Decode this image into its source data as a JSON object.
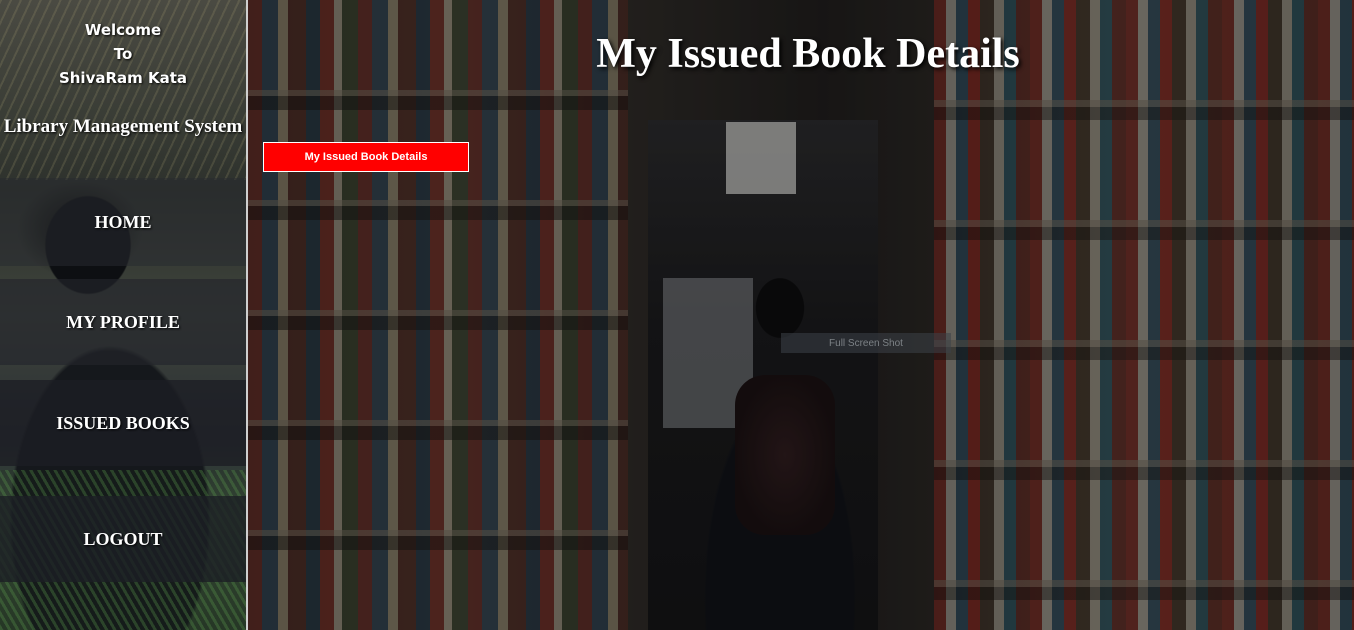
{
  "sidebar": {
    "welcome_line1": "Welcome",
    "welcome_line2": "To",
    "user_name": "ShivaRam Kata",
    "system_title": "Library Management System",
    "nav": {
      "home": "HOME",
      "profile": "MY PROFILE",
      "issued_books": "ISSUED BOOKS",
      "logout": "LOGOUT"
    }
  },
  "main": {
    "page_title": "My Issued Book Details",
    "issued_button_label": "My Issued Book Details",
    "faint_tooltip": "Full Screen Shot"
  },
  "colors": {
    "button_red": "#ff0000",
    "text_white": "#ffffff"
  }
}
